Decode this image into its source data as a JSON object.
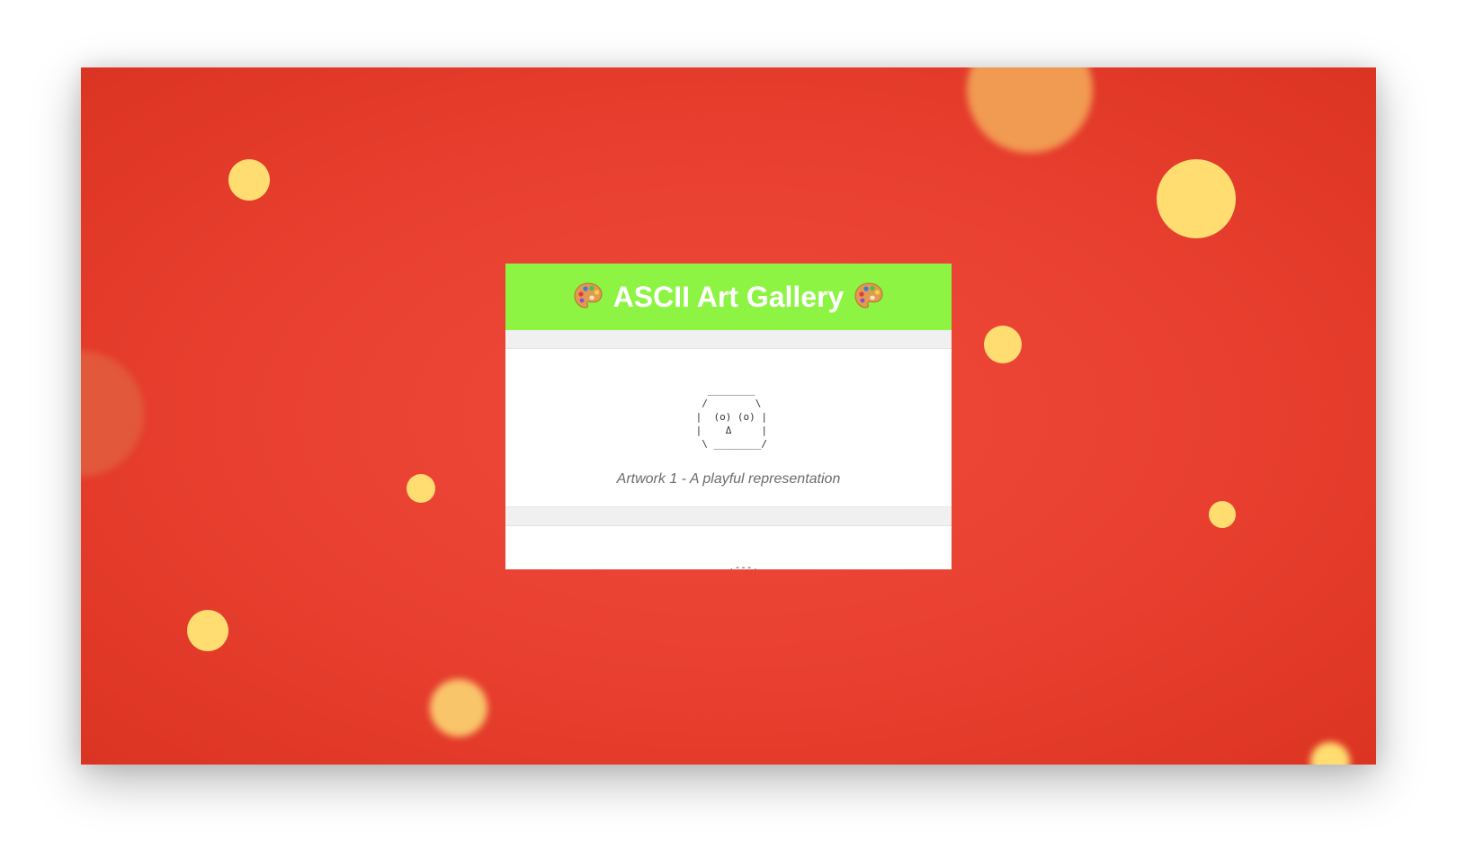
{
  "gallery": {
    "title": "ASCII Art Gallery",
    "title_icon": "artist-palette-icon",
    "colors": {
      "background": "#e83f30",
      "header": "#8df443",
      "bubble": "#ffdd70",
      "title_text": "#ffffff"
    },
    "artworks": [
      {
        "art": "   ________\n  /        \\\n |  (o) (o) |\n |    Δ     |\n  \\ ________/",
        "caption": "Artwork 1 - A playful representation"
      },
      {
        "art": "      ,---,\n     /     \\",
        "caption": ""
      }
    ]
  }
}
